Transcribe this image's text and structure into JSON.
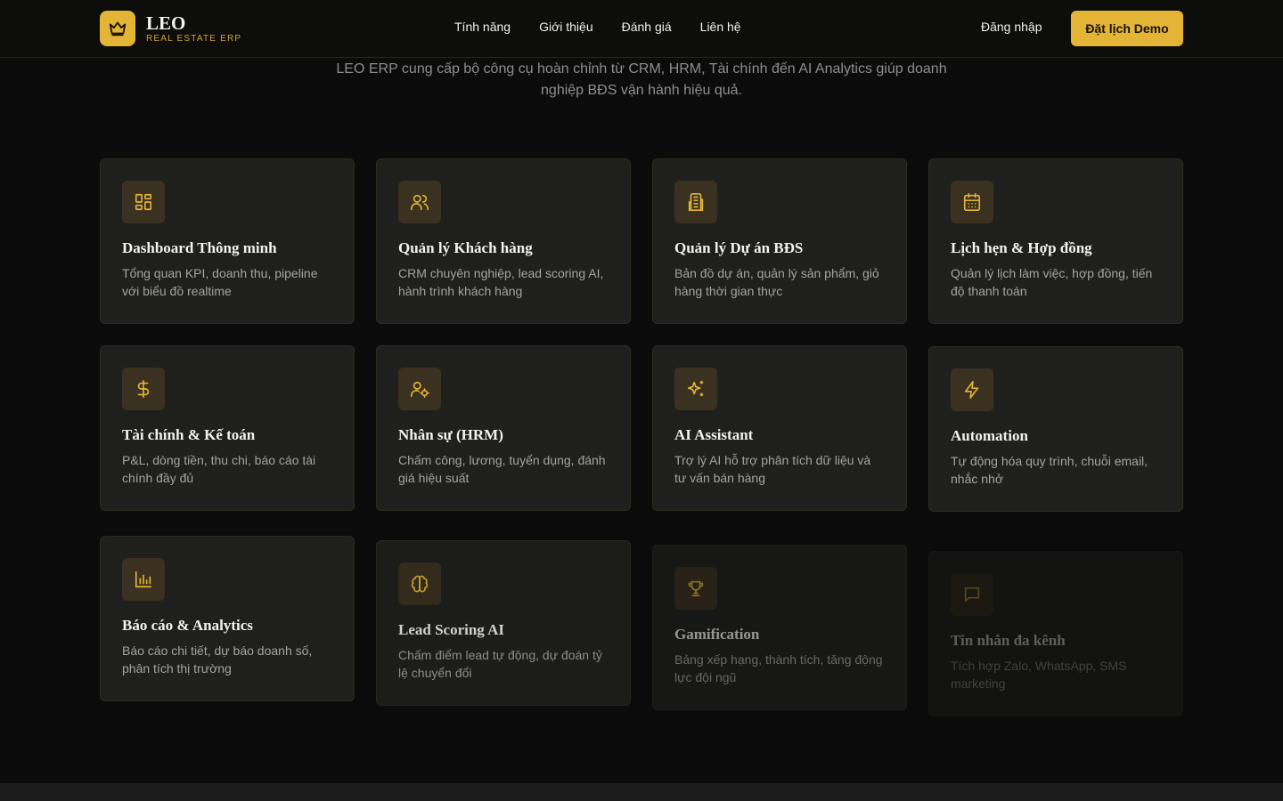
{
  "brand": {
    "name": "LEO",
    "subtitle": "REAL ESTATE ERP"
  },
  "nav": {
    "links": [
      "Tính năng",
      "Giới thiệu",
      "Đánh giá",
      "Liên hệ"
    ],
    "login": "Đăng nhập",
    "demo": "Đặt lịch Demo"
  },
  "hero": {
    "subtitle": "LEO ERP cung cấp bộ công cụ hoàn chỉnh từ CRM, HRM, Tài chính đến AI Analytics giúp doanh nghiệp BĐS vận hành hiệu quả."
  },
  "features": [
    {
      "title": "Dashboard Thông minh",
      "desc": "Tổng quan KPI, doanh thu, pipeline với biểu đồ realtime",
      "icon": "layout-grid-icon"
    },
    {
      "title": "Quản lý Khách hàng",
      "desc": "CRM chuyên nghiệp, lead scoring AI, hành trình khách hàng",
      "icon": "users-icon"
    },
    {
      "title": "Quản lý Dự án BĐS",
      "desc": "Bản đồ dự án, quản lý sản phẩm, giỏ hàng thời gian thực",
      "icon": "building-icon"
    },
    {
      "title": "Lịch hẹn & Hợp đồng",
      "desc": "Quản lý lịch làm việc, hợp đồng, tiến độ thanh toán",
      "icon": "calendar-icon"
    },
    {
      "title": "Tài chính & Kế toán",
      "desc": "P&L, dòng tiền, thu chi, báo cáo tài chính đầy đủ",
      "icon": "dollar-icon"
    },
    {
      "title": "Nhân sự (HRM)",
      "desc": "Chấm công, lương, tuyển dụng, đánh giá hiệu suất",
      "icon": "user-cog-icon"
    },
    {
      "title": "AI Assistant",
      "desc": "Trợ lý AI hỗ trợ phân tích dữ liệu và tư vấn bán hàng",
      "icon": "sparkles-icon"
    },
    {
      "title": "Automation",
      "desc": "Tự động hóa quy trình, chuỗi email, nhắc nhở",
      "icon": "lightning-icon"
    },
    {
      "title": "Báo cáo & Analytics",
      "desc": "Báo cáo chi tiết, dự báo doanh số, phân tích thị trường",
      "icon": "bar-chart-icon"
    },
    {
      "title": "Lead Scoring AI",
      "desc": "Chấm điểm lead tự động, dự đoán tỷ lệ chuyển đổi",
      "icon": "brain-icon"
    },
    {
      "title": "Gamification",
      "desc": "Bảng xếp hạng, thành tích, tăng động lực đội ngũ",
      "icon": "trophy-icon"
    },
    {
      "title": "Tin nhắn đa kênh",
      "desc": "Tích hợp Zalo, WhatsApp, SMS marketing",
      "icon": "message-icon"
    }
  ],
  "colors": {
    "accent": "#e4b437",
    "background": "#0b0b0b",
    "card": "#1f1f1e"
  }
}
